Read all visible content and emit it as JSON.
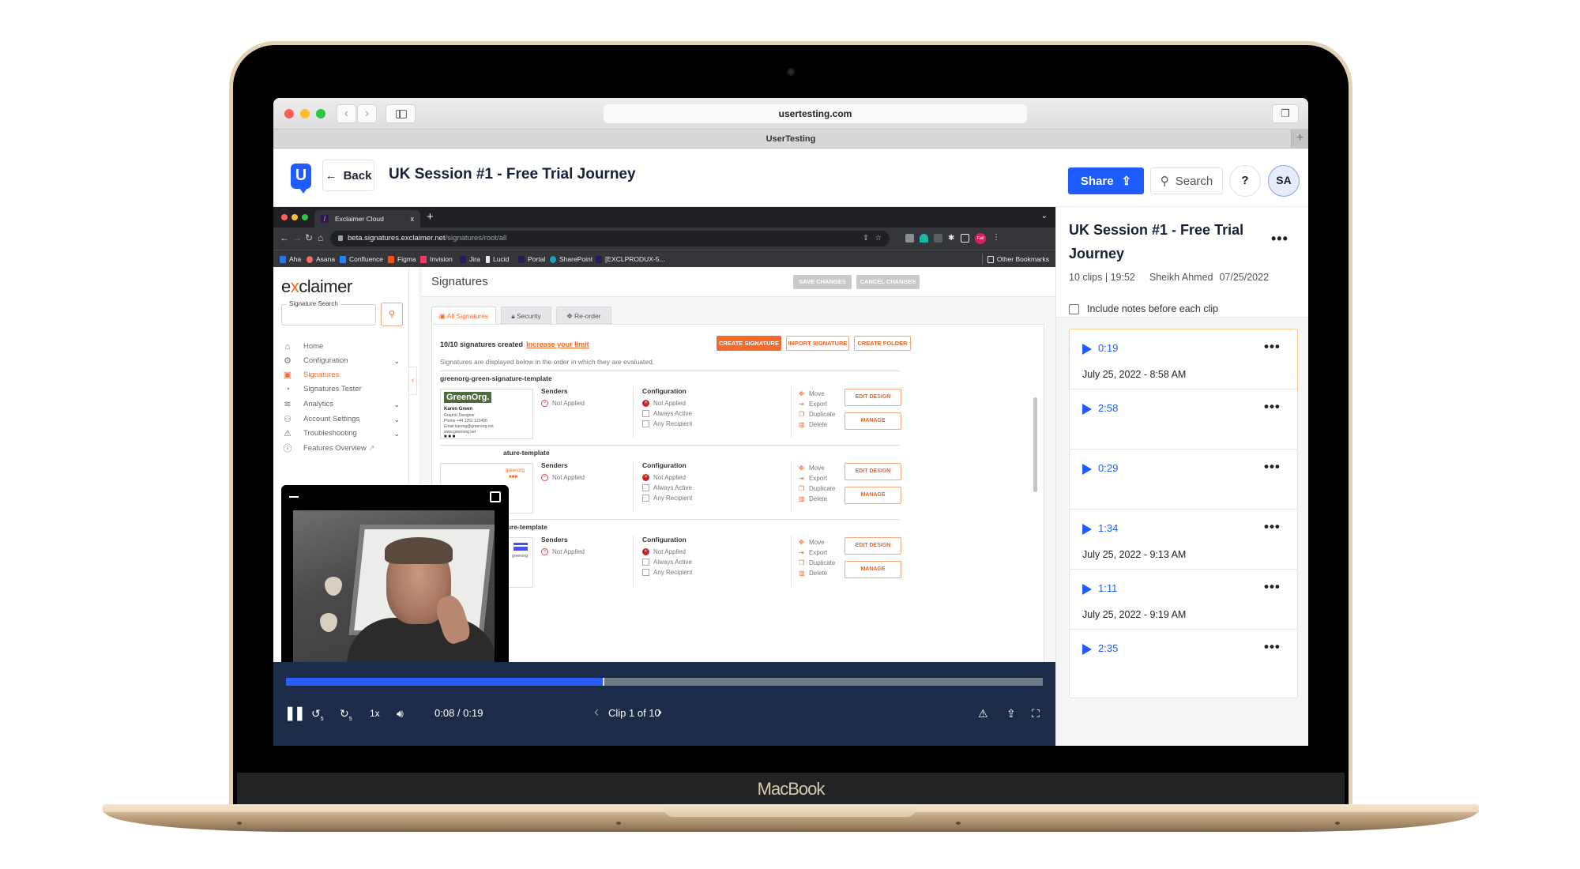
{
  "device": {
    "label": "MacBook"
  },
  "safari": {
    "url": "usertesting.com",
    "tab_title": "UserTesting",
    "new_tab_label": "+"
  },
  "header": {
    "logo_letter": "U",
    "back_label": "Back",
    "title": "UK Session #1 - Free Trial Journey",
    "share_label": "Share",
    "search_label": "Search",
    "help_label": "?",
    "avatar_initials": "SA",
    "accent_color": "#1f5cff"
  },
  "chrome": {
    "tab_title": "Exclaimer Cloud",
    "tab_close": "x",
    "url_host": "beta.signatures.exclaimer.net",
    "url_path": "/signatures/root/all",
    "profile_badge": "Fail",
    "bookmarks": [
      "Aha",
      "Asana",
      "Confluence",
      "Figma",
      "Invision",
      "Jira",
      "Lucid",
      "Portal",
      "SharePoint",
      "[EXCLPRODUX-5..."
    ],
    "other_bookmarks": "Other Bookmarks"
  },
  "exclaimer": {
    "logo_pre": "e",
    "logo_x": "x",
    "logo_post": "claimer",
    "search_label": "Signature Search",
    "nav": [
      {
        "label": "Home",
        "icon": "home-icon",
        "chevron": false,
        "active": false
      },
      {
        "label": "Configuration",
        "icon": "gears-icon",
        "chevron": true,
        "active": false
      },
      {
        "label": "Signatures",
        "icon": "signature-card-icon",
        "chevron": false,
        "active": true
      },
      {
        "label": "Signatures Tester",
        "icon": "gauge-icon",
        "chevron": false,
        "active": false
      },
      {
        "label": "Analytics",
        "icon": "analytics-icon",
        "chevron": true,
        "active": false
      },
      {
        "label": "Account Settings",
        "icon": "users-gear-icon",
        "chevron": true,
        "active": false
      },
      {
        "label": "Troubleshooting",
        "icon": "warning-icon",
        "chevron": true,
        "active": false
      },
      {
        "label": "Features Overview",
        "icon": "info-icon",
        "chevron": false,
        "active": false
      }
    ],
    "page_title": "Signatures",
    "save_changes": "SAVE CHANGES",
    "cancel_changes": "CANCEL CHANGES",
    "tabs": [
      {
        "label": "All Signatures",
        "active": true
      },
      {
        "label": "Security",
        "active": false
      },
      {
        "label": "Re-order",
        "active": false
      }
    ],
    "count_text": "10/10 signatures created",
    "increase_limit": "Increase your limit",
    "create_signature": "CREATE SIGNATURE",
    "import_signature": "IMPORT SIGNATURE",
    "create_folder": "CREATE FOLDER",
    "order_note": "Signatures are displayed below in the order in which they are evaluated.",
    "signatures": [
      {
        "name": "greenorg-green-signature-template",
        "thumb": {
          "brand": "GreenOrg.",
          "person": "Karen Green",
          "role": "Graphic Designer",
          "phone": "Phone   +44 1252 123456",
          "email": "Email   kareng@greenorg.net",
          "web": "www.greenorg.net"
        },
        "senders_label": "Senders",
        "senders_status": "Not Applied",
        "config_label": "Configuration",
        "config": [
          "Not Applied",
          "Always Active",
          "Any Recipient"
        ],
        "actions": [
          "Move",
          "Export",
          "Duplicate",
          "Delete"
        ],
        "edit_design": "EDIT DESIGN",
        "manage": "MANAGE"
      },
      {
        "name": "ature-template",
        "thumb": {
          "brand": "greenorg"
        },
        "senders_label": "Senders",
        "senders_status": "Not Applied",
        "config_label": "Configuration",
        "config": [
          "Not Applied",
          "Always Active",
          "Any Recipient"
        ],
        "actions": [
          "Move",
          "Export",
          "Duplicate",
          "Delete"
        ],
        "edit_design": "EDIT DESIGN",
        "manage": "MANAGE"
      },
      {
        "name": "ture-template",
        "thumb": {
          "brand": "greenorg"
        },
        "senders_label": "Senders",
        "senders_status": "Not Applied",
        "config_label": "Configuration",
        "config": [
          "Not Applied",
          "Always Active",
          "Any Recipient"
        ],
        "actions": [
          "Move",
          "Export",
          "Duplicate",
          "Delete"
        ],
        "edit_design": "EDIT DESIGN",
        "manage": "MANAGE"
      }
    ],
    "accent_color": "#f26b2a"
  },
  "player": {
    "progress_fraction": 0.42,
    "time": "0:08 / 0:19",
    "speed": "1x",
    "clip_label": "Clip 1 of 10",
    "skip_back_seconds": "5",
    "skip_forward_seconds": "5"
  },
  "panel": {
    "title": "UK Session #1 - Free Trial Journey",
    "meta_counts": "10 clips | 19:52",
    "meta_author": "Sheikh Ahmed",
    "meta_date": "07/25/2022",
    "include_notes_label": "Include notes before each clip",
    "include_notes_checked": false,
    "clips": [
      {
        "duration": "0:19",
        "date": "July 25, 2022 - 8:58 AM",
        "active": true
      },
      {
        "duration": "2:58",
        "date": "",
        "active": false
      },
      {
        "duration": "0:29",
        "date": "",
        "active": false
      },
      {
        "duration": "1:34",
        "date": "July 25, 2022 - 9:13 AM",
        "active": false
      },
      {
        "duration": "1:11",
        "date": "July 25, 2022 - 9:19 AM",
        "active": false
      },
      {
        "duration": "2:35",
        "date": "",
        "active": false
      }
    ]
  }
}
